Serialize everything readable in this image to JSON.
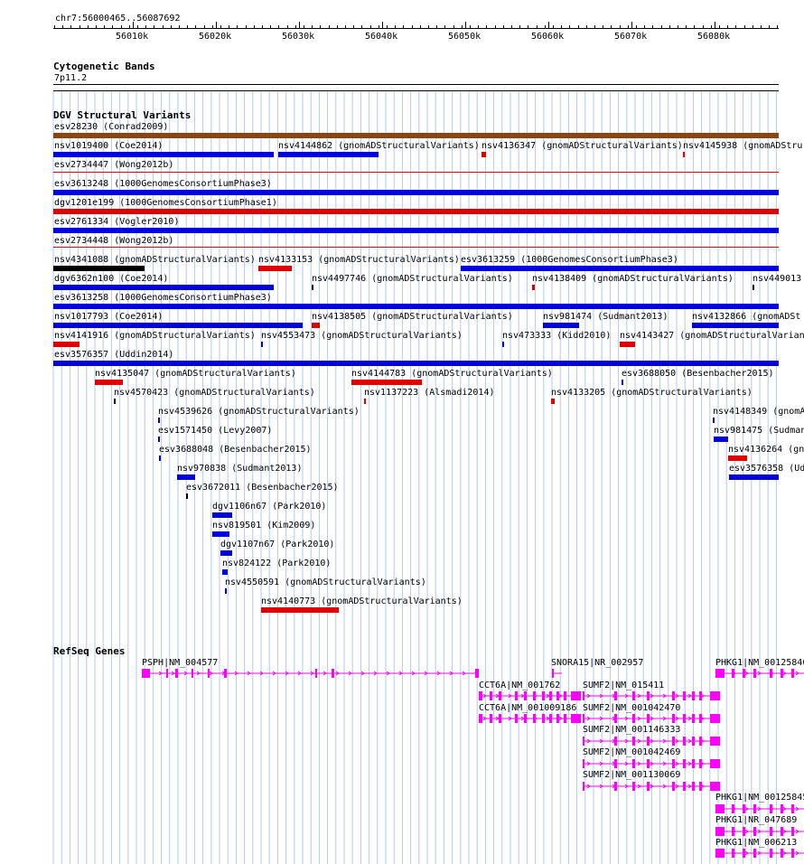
{
  "position": "chr7:56000465..56087692",
  "ruler": {
    "ticks": [
      "56010k",
      "56020k",
      "56030k",
      "56040k",
      "56050k",
      "56060k",
      "56070k",
      "56080k"
    ]
  },
  "colors": {
    "brown": "#8b4513",
    "blue": "#0000e0",
    "red": "#e00000",
    "black": "#000000",
    "magenta": "#ff00ff",
    "grid": "#b4c8f0"
  },
  "tracks": {
    "cytoband": {
      "title": "Cytogenetic Bands",
      "band": "7p11.2"
    },
    "dgv": {
      "title": "DGV Structural Variants"
    },
    "refseq": {
      "title": "RefSeq Genes"
    }
  },
  "dgv_labels": [
    "esv28230 (Conrad2009)",
    "nsv1019400 (Coe2014)",
    "nsv4144862 (gnomADStructuralVariants)",
    "nsv4136347 (gnomADStructuralVariants)",
    "nsv4145938 (gnomADStru",
    "esv2734447 (Wong2012b)",
    "esv3613248 (1000GenomesConsortiumPhase3)",
    "dgv1201e199 (1000GenomesConsortiumPhase1)",
    "esv2761334 (Vogler2010)",
    "esv2734448 (Wong2012b)",
    "nsv4341088 (gnomADStructuralVariants)",
    "nsv4133153 (gnomADStructuralVariants)",
    "esv3613259 (1000GenomesConsortiumPhase3)",
    "dgv6362n100 (Coe2014)",
    "nsv4497746 (gnomADStructuralVariants)",
    "nsv4138409 (gnomADStructuralVariants)",
    "nsv449013",
    "esv3613258 (1000GenomesConsortiumPhase3)",
    "nsv1017793 (Coe2014)",
    "nsv4138505 (gnomADStructuralVariants)",
    "nsv981474 (Sudmant2013)",
    "nsv4132866 (gnomADSt",
    "nsv4141916 (gnomADStructuralVariants)",
    "nsv4553473 (gnomADStructuralVariants)",
    "nsv473333 (Kidd2010)",
    "nsv4143427 (gnomADStructuralVarian",
    "esv3576357 (Uddin2014)",
    "nsv4135047 (gnomADStructuralVariants)",
    "nsv4144783 (gnomADStructuralVariants)",
    "esv3688050 (Besenbacher2015)",
    "nsv4570423 (gnomADStructuralVariants)",
    "nsv1137223 (Alsmadi2014)",
    "nsv4133205 (gnomADStructuralVariants)",
    "nsv4539626 (gnomADStructuralVariants)",
    "nsv4148349 (gnomAD",
    "esv1571450 (Levy2007)",
    "nsv981475 (Sudman",
    "esv3688048 (Besenbacher2015)",
    "nsv4136264 (gn",
    "nsv970838 (Sudmant2013)",
    "esv3576358 (Udd",
    "esv3672011 (Besenbacher2015)",
    "dgv1106n67 (Park2010)",
    "nsv819501 (Kim2009)",
    "dgv1107n67 (Park2010)",
    "nsv824122 (Park2010)",
    "nsv4550591 (gnomADStructuralVariants)",
    "nsv4140773 (gnomADStructuralVariants)"
  ],
  "gene_labels": [
    "PSPH|NM_004577",
    "SNORA15|NR_002957",
    "PHKG1|NM_00125846",
    "CCT6A|NM_001762",
    "SUMF2|NM_015411",
    "CCT6A|NM_001009186",
    "SUMF2|NM_001042470",
    "SUMF2|NM_001146333",
    "SUMF2|NM_001042469",
    "SUMF2|NM_001130069",
    "PHKG1|NM_00125845",
    "PHKG1|NR_047689",
    "PHKG1|NM_006213"
  ]
}
